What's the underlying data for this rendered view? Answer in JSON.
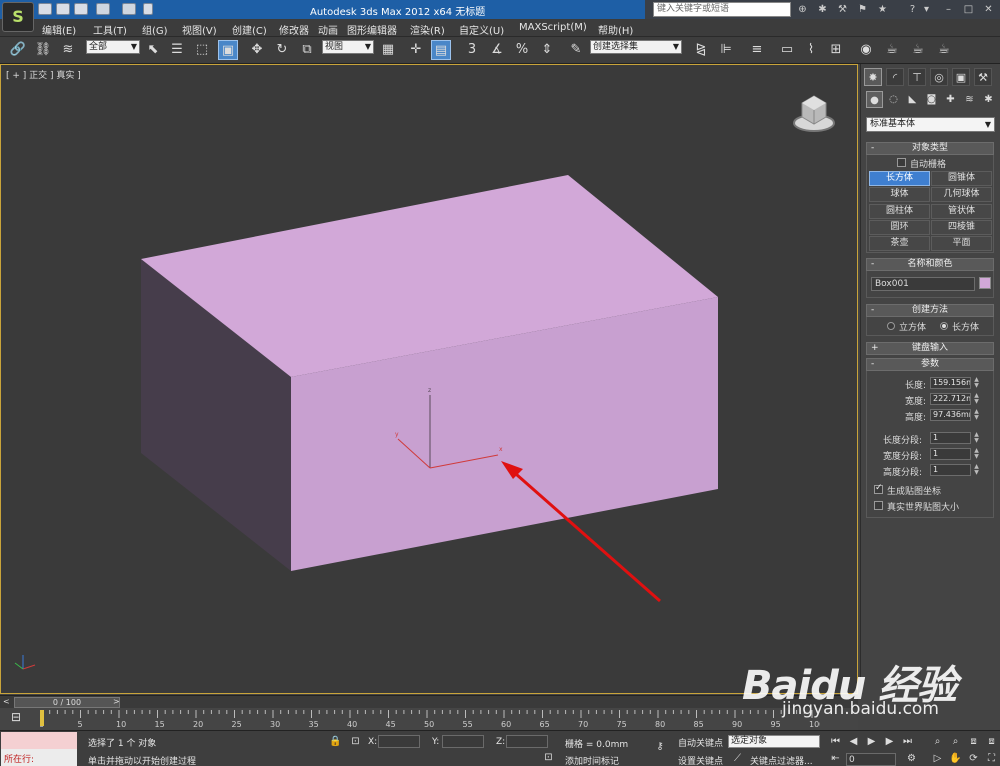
{
  "titlebar": {
    "app_logo": "S",
    "title": "Autodesk 3ds Max  2012 x64    无标题",
    "search_placeholder": "键入关键字或短语"
  },
  "menu": [
    "编辑(E)",
    "工具(T)",
    "组(G)",
    "视图(V)",
    "创建(C)",
    "修改器",
    "动画",
    "图形编辑器",
    "渲染(R)",
    "自定义(U)",
    "MAXScript(M)",
    "帮助(H)"
  ],
  "toolbar": {
    "selection_filter": "全部",
    "ref_coord": "视图",
    "named_selection": "创建选择集",
    "snap_label": "3"
  },
  "viewport": {
    "label": "[ + ] 正交 ] 真实 ]",
    "axis_labels": {
      "x": "x",
      "y": "y",
      "z": "z"
    },
    "object_color": "#d2a8d8",
    "annotation_color": "#e01010"
  },
  "command_panel": {
    "category": "标准基本体",
    "object_type": {
      "title": "对象类型",
      "auto_grid": "自动栅格",
      "buttons": [
        "长方体",
        "圆锥体",
        "球体",
        "几何球体",
        "圆柱体",
        "管状体",
        "圆环",
        "四棱锥",
        "茶壶",
        "平面"
      ],
      "active": "长方体"
    },
    "name_color": {
      "title": "名称和颜色",
      "name": "Box001",
      "color": "#d2a8d8"
    },
    "creation_method": {
      "title": "创建方法",
      "options": [
        "立方体",
        "长方体"
      ],
      "selected": "长方体"
    },
    "keyboard_entry": {
      "title": "键盘输入"
    },
    "parameters": {
      "title": "参数",
      "length_label": "长度:",
      "length": "159.156m",
      "width_label": "宽度:",
      "width": "222.712m",
      "height_label": "高度:",
      "height": "97.436mm",
      "length_segs_label": "长度分段:",
      "length_segs": "1",
      "width_segs_label": "宽度分段:",
      "width_segs": "1",
      "height_segs_label": "高度分段:",
      "height_segs": "1",
      "gen_map_coords": "生成贴图坐标",
      "real_world_map": "真实世界贴图大小"
    }
  },
  "timeline": {
    "frame_display": "0 / 100",
    "ticks": [
      "0",
      "5",
      "10",
      "15",
      "20",
      "25",
      "30",
      "35",
      "40",
      "45",
      "50",
      "55",
      "60",
      "65",
      "70",
      "75",
      "80",
      "85",
      "90",
      "95",
      "100"
    ]
  },
  "statusbar": {
    "maxscript_label": "所在行:",
    "selected_text": "选择了 1 个 对象",
    "prompt_text": "单击并拖动以开始创建过程",
    "x_label": "X:",
    "y_label": "Y:",
    "z_label": "Z:",
    "grid": "栅格 = 0.0mm",
    "add_time_tag": "添加时间标记",
    "auto_key": "自动关键点",
    "selected_drop": "选定对象",
    "set_key": "设置关键点",
    "key_filters": "关键点过滤器...",
    "frame": "0"
  },
  "watermark": {
    "brand": "Baidu 经验",
    "url": "jingyan.baidu.com"
  }
}
